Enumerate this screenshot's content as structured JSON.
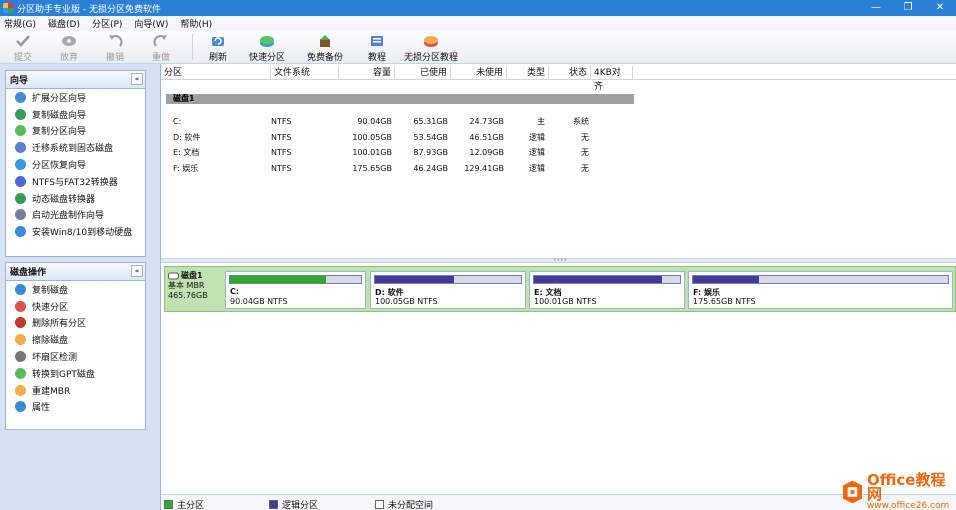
{
  "window": {
    "title": "分区助手专业版 - 无损分区免费软件",
    "controls": [
      "—",
      "❐",
      "✕"
    ]
  },
  "menu": [
    "常规(G)",
    "磁盘(D)",
    "分区(P)",
    "向导(W)",
    "帮助(H)"
  ],
  "toolbar": [
    {
      "label": "提交",
      "icon": "check-icon",
      "disabled": true
    },
    {
      "label": "放弃",
      "icon": "discard-icon",
      "disabled": true
    },
    {
      "label": "撤销",
      "icon": "undo-icon",
      "disabled": true
    },
    {
      "label": "重做",
      "icon": "redo-icon",
      "disabled": true
    },
    {
      "label": "刷新",
      "icon": "refresh-icon",
      "disabled": false
    },
    {
      "label": "快速分区",
      "icon": "quick-partition-icon",
      "disabled": false
    },
    {
      "label": "免费备份",
      "icon": "backup-icon",
      "disabled": false
    },
    {
      "label": "教程",
      "icon": "tutorial-icon",
      "disabled": false
    },
    {
      "label": "无损分区教程",
      "icon": "lossless-tutorial-icon",
      "disabled": false
    }
  ],
  "wizard": {
    "title": "向导",
    "collapse": "«",
    "items": [
      "扩展分区向导",
      "复制磁盘向导",
      "复制分区向导",
      "迁移系统到固态磁盘",
      "分区恢复向导",
      "NTFS与FAT32转换器",
      "动态磁盘转换器",
      "启动光盘制作向导",
      "安装Win8/10到移动硬盘"
    ]
  },
  "disk_ops": {
    "title": "磁盘操作",
    "collapse": "«",
    "items": [
      "复制磁盘",
      "快速分区",
      "删除所有分区",
      "擦除磁盘",
      "坏扇区检测",
      "转换到GPT磁盘",
      "重建MBR",
      "属性"
    ]
  },
  "table": {
    "columns": [
      "分区",
      "文件系统",
      "容量",
      "已使用",
      "未使用",
      "类型",
      "状态",
      "4KB对齐"
    ],
    "disk_label": "磁盘1",
    "rows": [
      {
        "name": "C:",
        "fs": "NTFS",
        "capacity": "90.04GB",
        "used": "65.31GB",
        "free": "24.73GB",
        "type": "主",
        "status": "系统"
      },
      {
        "name": "D: 软件",
        "fs": "NTFS",
        "capacity": "100.05GB",
        "used": "53.54GB",
        "free": "46.51GB",
        "type": "逻辑",
        "status": "无"
      },
      {
        "name": "E: 文档",
        "fs": "NTFS",
        "capacity": "100.01GB",
        "used": "87.93GB",
        "free": "12.09GB",
        "type": "逻辑",
        "status": "无"
      },
      {
        "name": "F: 娱乐",
        "fs": "NTFS",
        "capacity": "175.65GB",
        "used": "46.24GB",
        "free": "129.41GB",
        "type": "逻辑",
        "status": "无"
      }
    ]
  },
  "diskmap": {
    "disk_name": "磁盘1",
    "disk_type": "基本 MBR",
    "disk_size": "465.76GB",
    "partitions": [
      {
        "name": "C:",
        "info": "90.04GB NTFS",
        "used_fraction": 0.73,
        "color": "#2fa82f"
      },
      {
        "name": "D: 软件",
        "info": "100.05GB NTFS",
        "used_fraction": 0.54,
        "color": "#3d3d9a"
      },
      {
        "name": "E: 文档",
        "info": "100.01GB NTFS",
        "used_fraction": 0.88,
        "color": "#3d3d9a"
      },
      {
        "name": "F: 娱乐",
        "info": "175.65GB NTFS",
        "used_fraction": 0.26,
        "color": "#3d3d9a"
      }
    ]
  },
  "legend": [
    {
      "label": "主分区",
      "color": "#2fa82f"
    },
    {
      "label": "逻辑分区",
      "color": "#3d3d9a"
    },
    {
      "label": "未分配空间",
      "color": "#ffffff"
    }
  ],
  "watermark": {
    "line1": "Office教程网",
    "line2": "www.office26.com"
  }
}
